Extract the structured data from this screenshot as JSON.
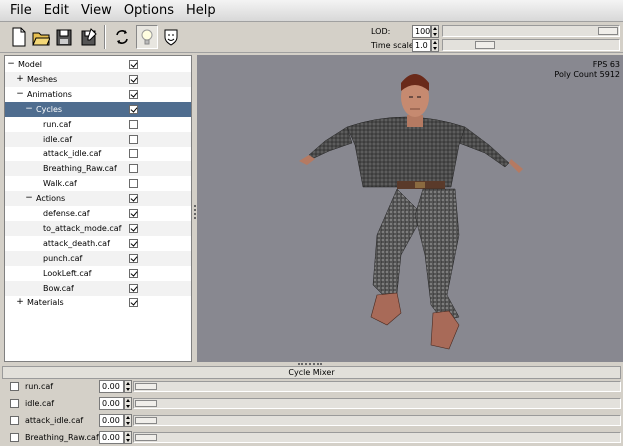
{
  "menubar": {
    "items": [
      "File",
      "Edit",
      "View",
      "Options",
      "Help"
    ]
  },
  "toolbar": {
    "buttons": [
      "new-file-icon",
      "open-folder-icon",
      "save-icon",
      "save-as-icon",
      "refresh-icon",
      "light-bulb-icon",
      "shield-icon"
    ],
    "lod_label": "LOD:",
    "lod_value": "100",
    "lod_level": 1.0,
    "timescale_label": "Time scale:",
    "timescale_value": "1.0",
    "timescale_level": 0.2
  },
  "tree": {
    "rows": [
      {
        "label": "Model",
        "expander": "−",
        "checked": true
      },
      {
        "label": "Meshes",
        "expander": "+",
        "checked": true
      },
      {
        "label": "Animations",
        "expander": "−",
        "checked": true
      },
      {
        "label": "Cycles",
        "expander": "−",
        "checked": true,
        "selected": true
      },
      {
        "label": "run.caf",
        "checked": false
      },
      {
        "label": "idle.caf",
        "checked": false
      },
      {
        "label": "attack_idle.caf",
        "checked": false
      },
      {
        "label": "Breathing_Raw.caf",
        "checked": false
      },
      {
        "label": "Walk.caf",
        "checked": false
      },
      {
        "label": "Actions",
        "expander": "−",
        "checked": true
      },
      {
        "label": "defense.caf",
        "checked": true
      },
      {
        "label": "to_attack_mode.caf",
        "checked": true
      },
      {
        "label": "attack_death.caf",
        "checked": true
      },
      {
        "label": "punch.caf",
        "checked": true
      },
      {
        "label": "LookLeft.caf",
        "checked": true
      },
      {
        "label": "Bow.caf",
        "checked": true
      },
      {
        "label": "Materials",
        "expander": "+",
        "checked": true
      }
    ]
  },
  "viewport": {
    "fps": "FPS 63",
    "poly_count": "Poly Count 5912",
    "background": "#888890"
  },
  "mixer": {
    "title": "Cycle Mixer",
    "rows": [
      {
        "name": "run.caf",
        "weight": "0.00",
        "checked": false
      },
      {
        "name": "idle.caf",
        "weight": "0.00",
        "checked": false
      },
      {
        "name": "attack_idle.caf",
        "weight": "0.00",
        "checked": false
      },
      {
        "name": "Breathing_Raw.caf",
        "weight": "0.00",
        "checked": false
      }
    ]
  },
  "colors": {
    "selection": "#4f6d8f",
    "panel": "#d4d0c8"
  }
}
